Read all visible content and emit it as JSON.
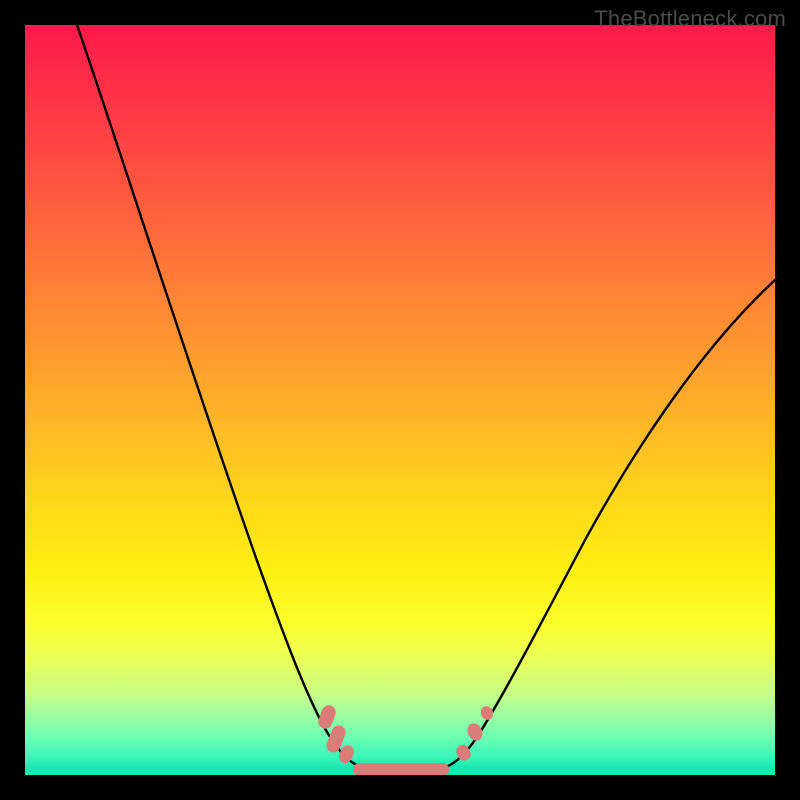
{
  "watermark": "TheBottleneck.com",
  "colors": {
    "frame": "#000000",
    "curve": "#000000",
    "marker": "#da7c78",
    "gradient_top": "#ff1a4a",
    "gradient_bottom": "#16e4af"
  },
  "chart_data": {
    "type": "line",
    "title": "",
    "xlabel": "",
    "ylabel": "",
    "xlim": [
      0,
      100
    ],
    "ylim": [
      0,
      100
    ],
    "note": "No visible axes, tick labels, or numeric annotations. Values below are the curve shape expressed in percent of the plot area (x left→right, y bottom→top). Background color gradient runs red (top, high y) to green (bottom, low y).",
    "series": [
      {
        "name": "curve",
        "x": [
          7,
          10,
          15,
          20,
          25,
          30,
          35,
          38,
          40,
          42,
          44,
          46,
          48,
          50,
          52,
          54,
          56,
          58,
          60,
          65,
          70,
          75,
          80,
          85,
          90,
          95,
          100
        ],
        "y": [
          100,
          90,
          75,
          60,
          47,
          34,
          22,
          15,
          11,
          7,
          4,
          2,
          1,
          1,
          1,
          1,
          2,
          4,
          7,
          15,
          24,
          33,
          41,
          48,
          55,
          61,
          66
        ]
      }
    ],
    "markers": {
      "name": "highlighted-points",
      "description": "Pink rounded markers clustered at the trough of the curve.",
      "left_cluster": {
        "x_range": [
          40,
          44
        ],
        "y_range": [
          3,
          11
        ]
      },
      "flat_bottom": {
        "x_range": [
          44,
          56
        ],
        "y_range": [
          0.5,
          2
        ]
      },
      "right_cluster": {
        "x_range": [
          57,
          61
        ],
        "y_range": [
          3,
          9
        ]
      }
    }
  }
}
